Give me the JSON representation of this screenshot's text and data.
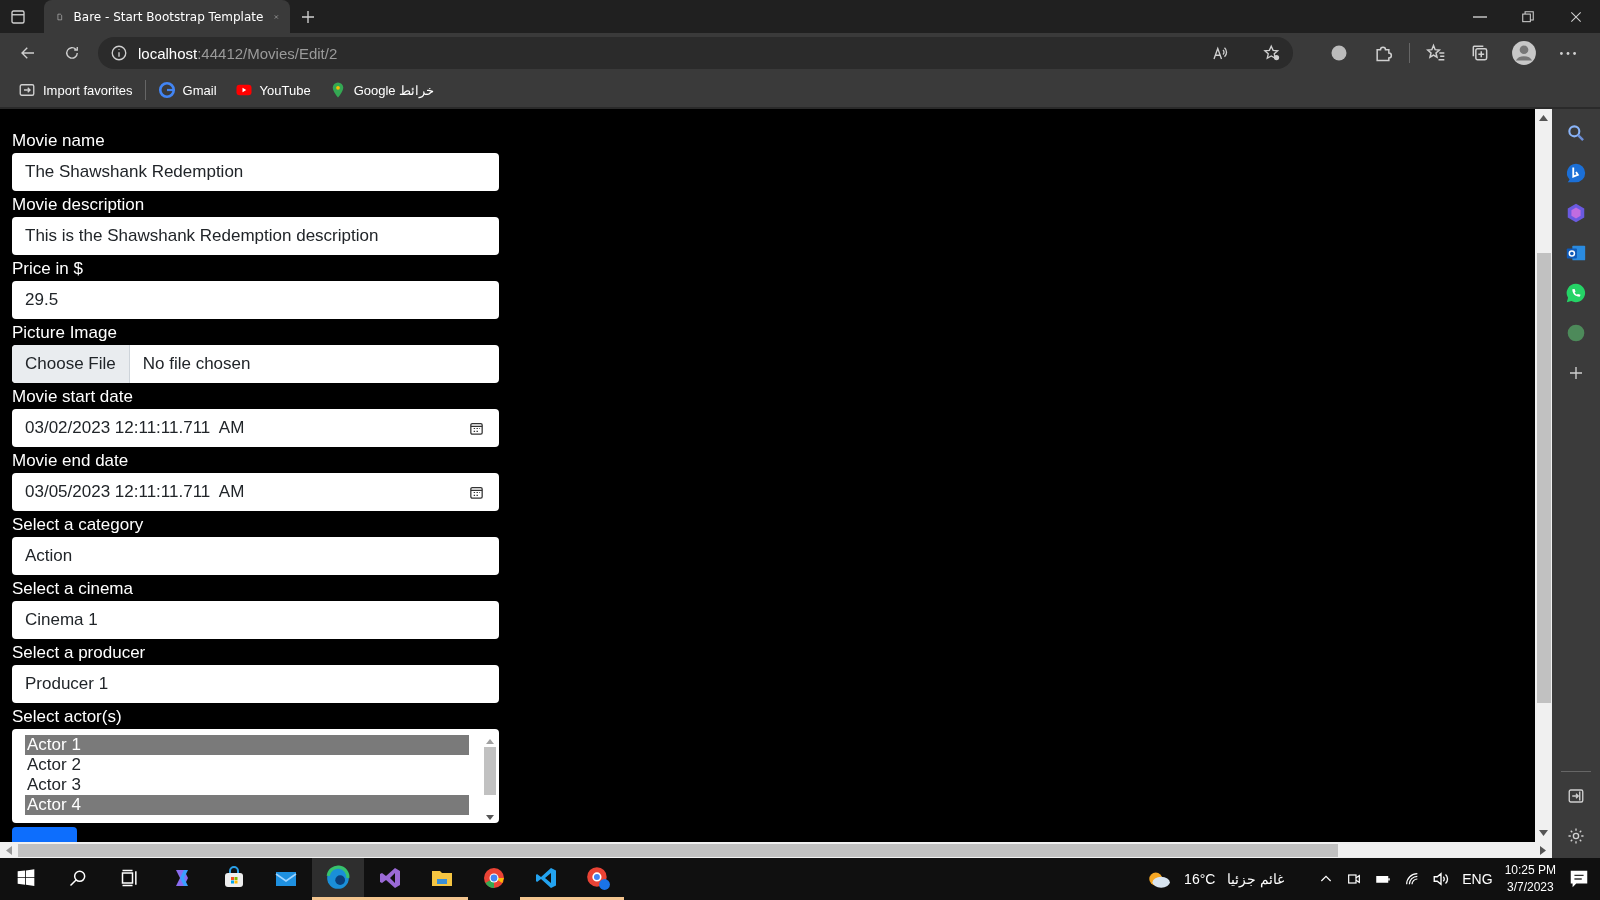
{
  "browser": {
    "tab": {
      "title": "Bare - Start Bootstrap Template",
      "selected": true
    },
    "address": {
      "host": "localhost",
      "path": ":44412/Movies/Edit/2"
    },
    "bookmarks": [
      {
        "kind": "import",
        "label": "Import favorites"
      },
      {
        "kind": "gmail",
        "label": "Gmail"
      },
      {
        "kind": "youtube",
        "label": "YouTube"
      },
      {
        "kind": "maps",
        "label": "Google خرائط"
      }
    ]
  },
  "form": {
    "fields": [
      {
        "kind": "text",
        "label": "Movie name",
        "value": "The Shawshank Redemption"
      },
      {
        "kind": "text",
        "label": "Movie description",
        "value": "This is the Shawshank Redemption description"
      },
      {
        "kind": "text",
        "label": "Price in $",
        "value": "29.5"
      },
      {
        "kind": "file",
        "label": "Picture Image",
        "button": "Choose File",
        "status": "No file chosen"
      },
      {
        "kind": "datetime",
        "label": "Movie start date",
        "value": "03/02/2023 12:11:11.711  AM"
      },
      {
        "kind": "datetime",
        "label": "Movie end date",
        "value": "03/05/2023 12:11:11.711  AM"
      },
      {
        "kind": "select",
        "label": "Select a category",
        "value": "Action"
      },
      {
        "kind": "select",
        "label": "Select a cinema",
        "value": "Cinema 1"
      },
      {
        "kind": "select",
        "label": "Select a producer",
        "value": "Producer 1"
      },
      {
        "kind": "multiselect",
        "label": "Select actor(s)",
        "options": [
          {
            "label": "Actor 1",
            "selected": true
          },
          {
            "label": "Actor 2",
            "selected": false
          },
          {
            "label": "Actor 3",
            "selected": false
          },
          {
            "label": "Actor 4",
            "selected": true
          }
        ]
      }
    ]
  },
  "taskbar": {
    "apps": [
      {
        "kind": "copilot",
        "open": false,
        "selected": false
      },
      {
        "kind": "store",
        "open": false,
        "selected": false
      },
      {
        "kind": "mail",
        "open": false,
        "selected": false
      },
      {
        "kind": "edge",
        "open": true,
        "selected": true
      },
      {
        "kind": "visualstudio",
        "open": true,
        "selected": false
      },
      {
        "kind": "explorer",
        "open": true,
        "selected": false
      },
      {
        "kind": "chrome",
        "open": false,
        "selected": false
      },
      {
        "kind": "vscode",
        "open": true,
        "selected": false
      },
      {
        "kind": "chromeprofile",
        "open": true,
        "selected": false
      }
    ],
    "weather": {
      "temperature": "16°C",
      "condition": "غائم جزئيا"
    },
    "language": "ENG",
    "time": "10:25 PM",
    "date": "3/7/2023"
  }
}
